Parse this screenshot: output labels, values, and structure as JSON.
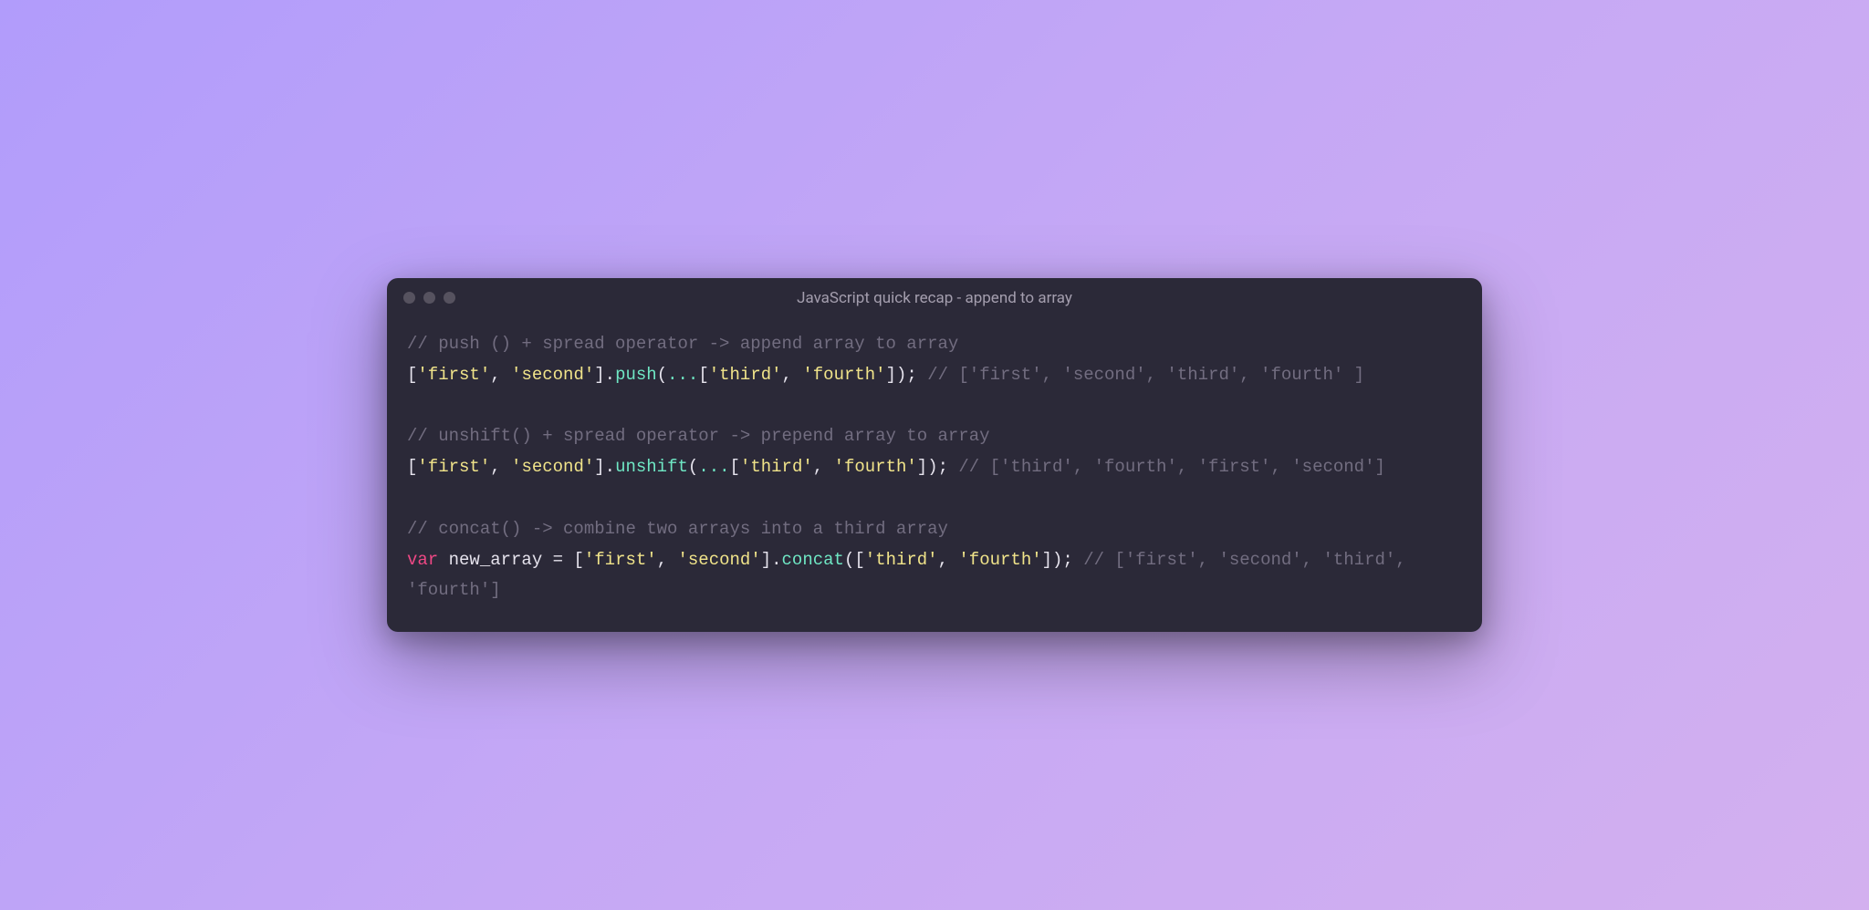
{
  "window": {
    "title": "JavaScript quick recap - append to array"
  },
  "code": {
    "lines": [
      [
        {
          "c": "comment",
          "t": "// push () + spread operator -> append array to array"
        }
      ],
      [
        {
          "c": "punct",
          "t": "["
        },
        {
          "c": "string",
          "t": "'first'"
        },
        {
          "c": "punct",
          "t": ", "
        },
        {
          "c": "string",
          "t": "'second'"
        },
        {
          "c": "punct",
          "t": "]."
        },
        {
          "c": "method",
          "t": "push"
        },
        {
          "c": "punct",
          "t": "("
        },
        {
          "c": "spread",
          "t": "..."
        },
        {
          "c": "punct",
          "t": "["
        },
        {
          "c": "string",
          "t": "'third'"
        },
        {
          "c": "punct",
          "t": ", "
        },
        {
          "c": "string",
          "t": "'fourth'"
        },
        {
          "c": "punct",
          "t": "]); "
        },
        {
          "c": "comment",
          "t": "// ['first', 'second', 'third', 'fourth' ]"
        }
      ],
      [],
      [
        {
          "c": "comment",
          "t": "// unshift() + spread operator -> prepend array to array"
        }
      ],
      [
        {
          "c": "punct",
          "t": "["
        },
        {
          "c": "string",
          "t": "'first'"
        },
        {
          "c": "punct",
          "t": ", "
        },
        {
          "c": "string",
          "t": "'second'"
        },
        {
          "c": "punct",
          "t": "]."
        },
        {
          "c": "method",
          "t": "unshift"
        },
        {
          "c": "punct",
          "t": "("
        },
        {
          "c": "spread",
          "t": "..."
        },
        {
          "c": "punct",
          "t": "["
        },
        {
          "c": "string",
          "t": "'third'"
        },
        {
          "c": "punct",
          "t": ", "
        },
        {
          "c": "string",
          "t": "'fourth'"
        },
        {
          "c": "punct",
          "t": "]); "
        },
        {
          "c": "comment",
          "t": "// ['third', 'fourth', 'first', 'second']"
        }
      ],
      [],
      [
        {
          "c": "comment",
          "t": "// concat() -> combine two arrays into a third array"
        }
      ],
      [
        {
          "c": "keyword",
          "t": "var"
        },
        {
          "c": "ident",
          "t": " new_array "
        },
        {
          "c": "punct",
          "t": "= ["
        },
        {
          "c": "string",
          "t": "'first'"
        },
        {
          "c": "punct",
          "t": ", "
        },
        {
          "c": "string",
          "t": "'second'"
        },
        {
          "c": "punct",
          "t": "]."
        },
        {
          "c": "method",
          "t": "concat"
        },
        {
          "c": "punct",
          "t": "(["
        },
        {
          "c": "string",
          "t": "'third'"
        },
        {
          "c": "punct",
          "t": ", "
        },
        {
          "c": "string",
          "t": "'fourth'"
        },
        {
          "c": "punct",
          "t": "]); "
        },
        {
          "c": "comment",
          "t": "// ['first', 'second', 'third', 'fourth']"
        }
      ]
    ]
  }
}
